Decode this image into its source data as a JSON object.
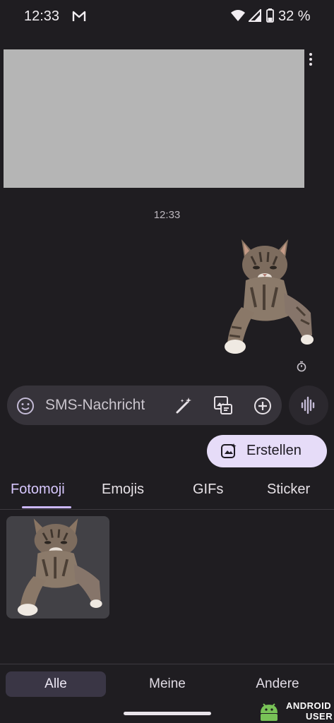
{
  "status_bar": {
    "time": "12:33",
    "battery": "32 %"
  },
  "conversation": {
    "timestamp": "12:33"
  },
  "compose": {
    "placeholder": "SMS-Nachricht"
  },
  "create_button": {
    "label": "Erstellen"
  },
  "tabs": [
    {
      "label": "Fotomoji",
      "selected": true
    },
    {
      "label": "Emojis"
    },
    {
      "label": "GIFs"
    },
    {
      "label": "Sticker"
    }
  ],
  "filter": [
    {
      "label": "Alle",
      "selected": true
    },
    {
      "label": "Meine"
    },
    {
      "label": "Andere"
    }
  ],
  "watermark": {
    "line1": "ANDROID",
    "line2": "USER"
  },
  "colors": {
    "accent": "#cdb8ff",
    "pill": "#e6dcf8",
    "background": "#1f1d21"
  }
}
